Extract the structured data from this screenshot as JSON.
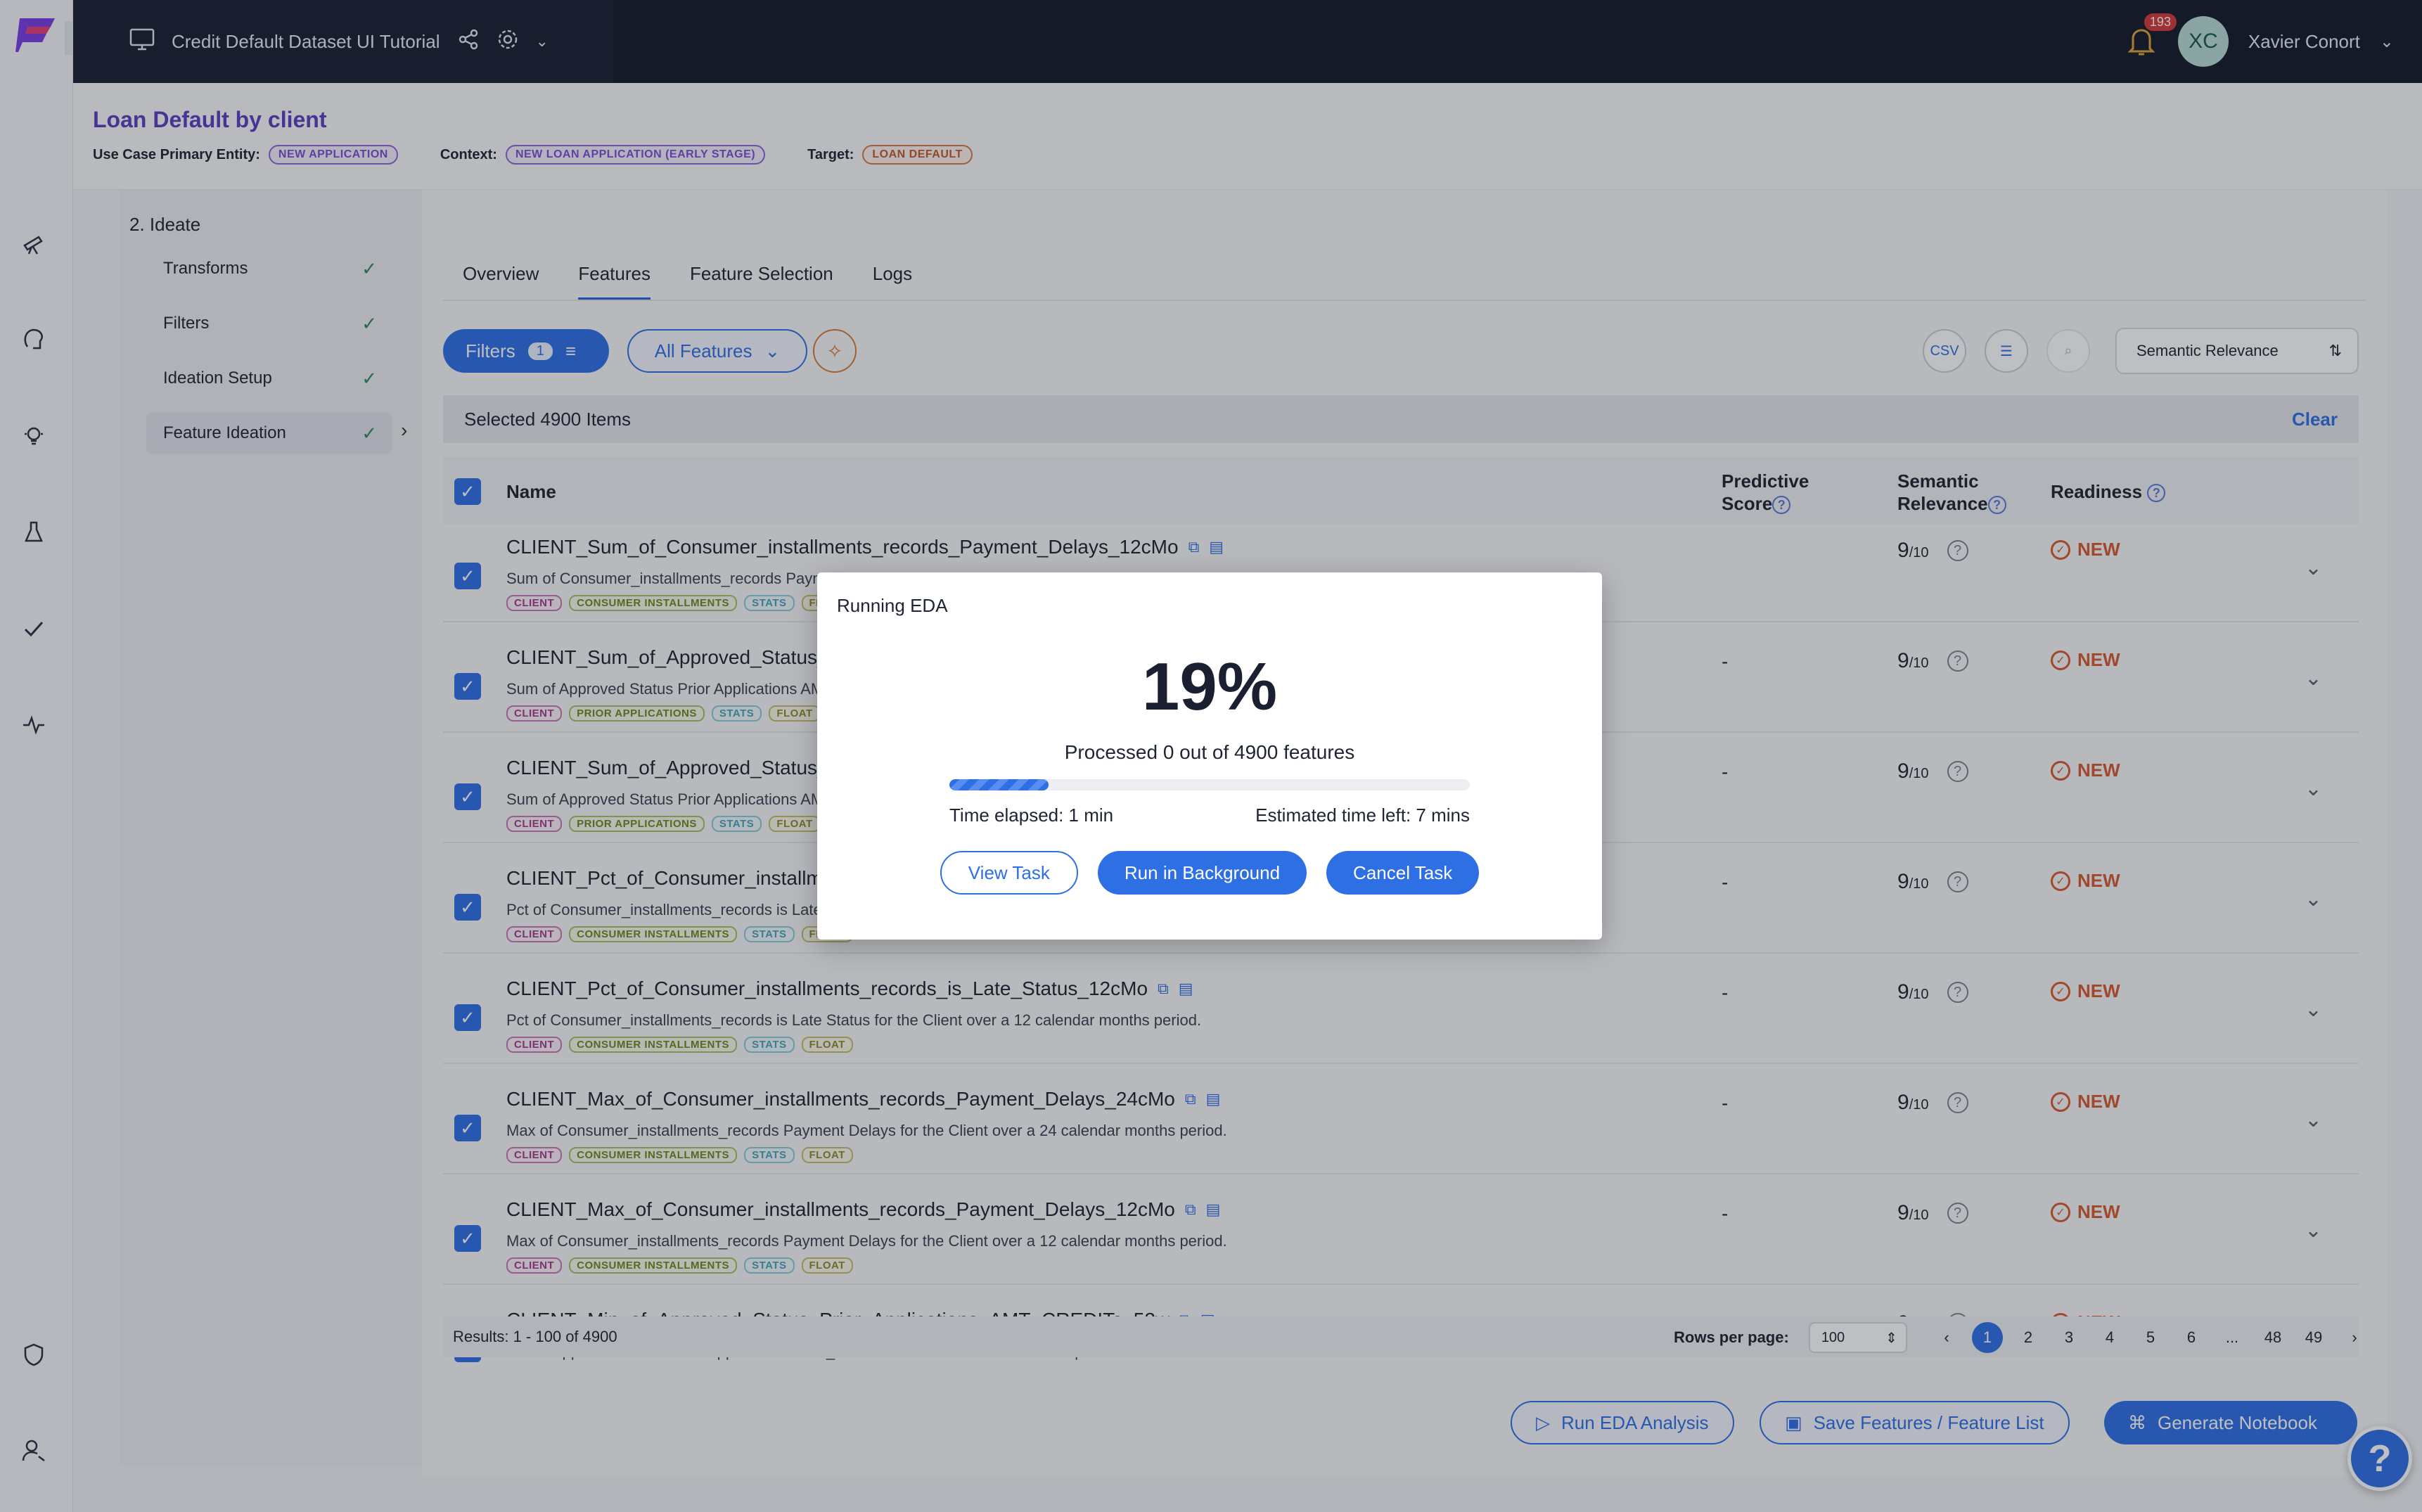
{
  "topbar": {
    "title": "Credit Default Dataset UI Tutorial",
    "notification_count": "193",
    "avatar_initials": "XC",
    "user_name": "Xavier Conort"
  },
  "use_case": {
    "title": "Loan Default by client",
    "primary_entity_label": "Use Case Primary Entity:",
    "primary_entity_value": "NEW APPLICATION",
    "context_label": "Context:",
    "context_value": "NEW LOAN APPLICATION (EARLY STAGE)",
    "target_label": "Target:",
    "target_value": "LOAN DEFAULT"
  },
  "steps": {
    "heading": "2. Ideate",
    "items": [
      {
        "label": "Transforms"
      },
      {
        "label": "Filters"
      },
      {
        "label": "Ideation Setup"
      },
      {
        "label": "Feature Ideation"
      }
    ]
  },
  "tabs": [
    "Overview",
    "Features",
    "Feature Selection",
    "Logs"
  ],
  "toolbar": {
    "filters_label": "Filters",
    "filters_count": "1",
    "all_features_label": "All Features",
    "sort_label": "Semantic Relevance"
  },
  "selection": {
    "text": "Selected 4900 Items",
    "clear_label": "Clear"
  },
  "table": {
    "headers": {
      "name": "Name",
      "predictive_line1": "Predictive",
      "predictive_line2": "Score",
      "semantic_line1": "Semantic",
      "semantic_line2": "Relevance",
      "readiness": "Readiness"
    },
    "rows": [
      {
        "name": "CLIENT_Sum_of_Consumer_installments_records_Payment_Delays_12cMo",
        "desc": "Sum of Consumer_installments_records Payment Delays for the Client over a 12 calendar months period.",
        "tags": [
          "CLIENT",
          "CONSUMER INSTALLMENTS",
          "STATS",
          "FLOAT"
        ],
        "score": "",
        "relevance": "9",
        "relevance_den": "/10",
        "readiness": "NEW"
      },
      {
        "name": "CLIENT_Sum_of_Approved_Status_Prior_Applications_AMT_CREDITs_12cMo",
        "desc": "Sum of Approved Status Prior Applications AMT_CREDITs for the Client over a 12 calendar months period.",
        "tags": [
          "CLIENT",
          "PRIOR APPLICATIONS",
          "STATS",
          "FLOAT"
        ],
        "score": "-",
        "relevance": "9",
        "relevance_den": "/10",
        "readiness": "NEW"
      },
      {
        "name": "CLIENT_Sum_of_Approved_Status_Prior_Applications_AMT_CREDITs_24cMo",
        "desc": "Sum of Approved Status Prior Applications AMT_CREDITs for the Client over a 24 calendar months period.",
        "tags": [
          "CLIENT",
          "PRIOR APPLICATIONS",
          "STATS",
          "FLOAT"
        ],
        "score": "-",
        "relevance": "9",
        "relevance_den": "/10",
        "readiness": "NEW"
      },
      {
        "name": "CLIENT_Pct_of_Consumer_installments_records_is_Late_Status_24cMo",
        "desc": "Pct of Consumer_installments_records is Late Status for the Client over a 24 calendar months period.",
        "tags": [
          "CLIENT",
          "CONSUMER INSTALLMENTS",
          "STATS",
          "FLOAT"
        ],
        "score": "-",
        "relevance": "9",
        "relevance_den": "/10",
        "readiness": "NEW"
      },
      {
        "name": "CLIENT_Pct_of_Consumer_installments_records_is_Late_Status_12cMo",
        "desc": "Pct of Consumer_installments_records is Late Status for the Client over a 12 calendar months period.",
        "tags": [
          "CLIENT",
          "CONSUMER INSTALLMENTS",
          "STATS",
          "FLOAT"
        ],
        "score": "-",
        "relevance": "9",
        "relevance_den": "/10",
        "readiness": "NEW"
      },
      {
        "name": "CLIENT_Max_of_Consumer_installments_records_Payment_Delays_24cMo",
        "desc": "Max of Consumer_installments_records Payment Delays for the Client over a 24 calendar months period.",
        "tags": [
          "CLIENT",
          "CONSUMER INSTALLMENTS",
          "STATS",
          "FLOAT"
        ],
        "score": "-",
        "relevance": "9",
        "relevance_den": "/10",
        "readiness": "NEW"
      },
      {
        "name": "CLIENT_Max_of_Consumer_installments_records_Payment_Delays_12cMo",
        "desc": "Max of Consumer_installments_records Payment Delays for the Client over a 12 calendar months period.",
        "tags": [
          "CLIENT",
          "CONSUMER INSTALLMENTS",
          "STATS",
          "FLOAT"
        ],
        "score": "-",
        "relevance": "9",
        "relevance_den": "/10",
        "readiness": "NEW"
      },
      {
        "name": "CLIENT_Min_of_Approved_Status_Prior_Applications_AMT_CREDITs_52w",
        "desc": "Min of Approved Status Prior Applications AMT_CREDITs for the Client over a 52w period.",
        "tags": [],
        "score": "-",
        "relevance": "9",
        "relevance_den": "/10",
        "readiness": "NEW"
      }
    ]
  },
  "footer": {
    "results": "Results: 1 - 100 of 4900",
    "rows_per_page_label": "Rows per page:",
    "rows_per_page_value": "100",
    "pages": [
      "1",
      "2",
      "3",
      "4",
      "5",
      "6",
      "...",
      "48",
      "49"
    ]
  },
  "actions": {
    "run_eda": "Run EDA Analysis",
    "save_features": "Save Features / Feature List",
    "generate_notebook": "Generate Notebook"
  },
  "modal": {
    "title": "Running EDA",
    "percent": "19%",
    "progress": 0.19,
    "processed": "Processed 0 out of 4900 features",
    "elapsed": "Time elapsed: 1 min",
    "estimated": "Estimated time left: 7 mins",
    "view_task": "View Task",
    "run_background": "Run in Background",
    "cancel_task": "Cancel Task"
  },
  "colors": {
    "accent": "#2f6fe4",
    "topbar": "#161b2c",
    "title_purple": "#5a3fbf",
    "ready_orange": "#d65a2e"
  }
}
